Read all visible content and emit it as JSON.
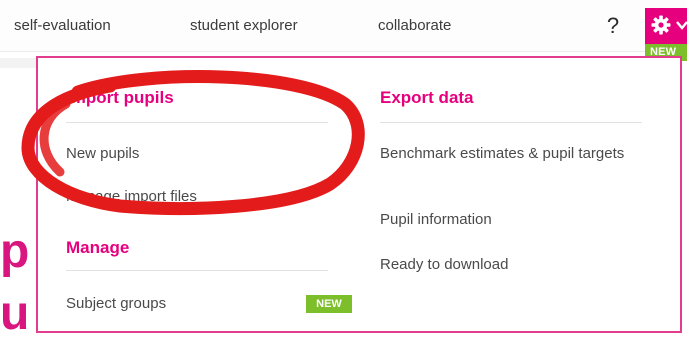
{
  "nav": {
    "items": [
      "self-evaluation",
      "student explorer",
      "collaborate"
    ],
    "help_label": "?",
    "settings_new_flag": "NEW"
  },
  "dropdown": {
    "import": {
      "heading": "Import pupils",
      "links": [
        "New pupils",
        "Manage import files"
      ]
    },
    "manage": {
      "heading": "Manage",
      "links": [
        "Subject groups"
      ],
      "badge": "NEW"
    },
    "export": {
      "heading": "Export data",
      "links": [
        "Benchmark estimates & pupil targets",
        "Pupil information",
        "Ready to download"
      ]
    }
  },
  "colors": {
    "accent": "#e6007e",
    "badge_green": "#7dbf2b",
    "annotation_red": "#e41b1b"
  },
  "icons": [
    "gear-icon",
    "chevron-down-icon"
  ]
}
